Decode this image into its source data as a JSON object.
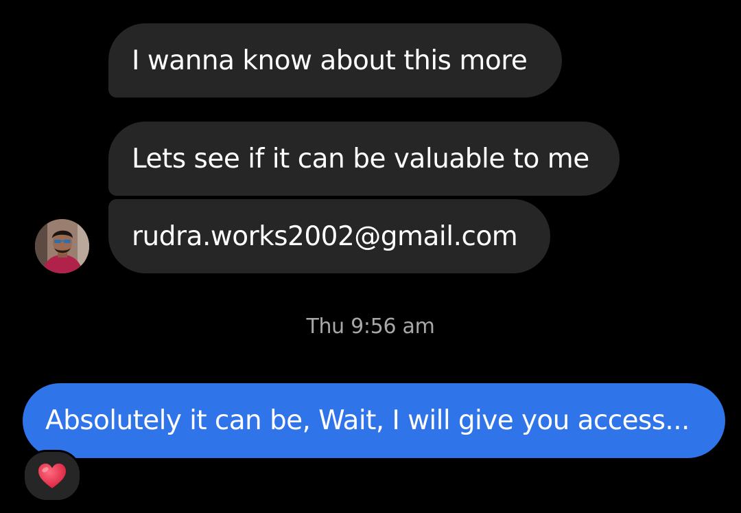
{
  "messages": [
    {
      "text": "I wanna know about this more"
    },
    {
      "text": "Lets see if it can be valuable to me"
    },
    {
      "text": "rudra.works2002@gmail.com"
    }
  ],
  "timestamp": "Thu 9:56 am",
  "reply": {
    "text": "Absolutely it can be, Wait, I will give you access..."
  },
  "reaction": {
    "icon": "heart-icon"
  },
  "colors": {
    "background": "#000000",
    "incoming_bubble": "#262626",
    "outgoing_bubble": "#2f74e8",
    "text": "#ffffff",
    "timestamp": "#a8a8a8",
    "reaction_heart": "#e8344a"
  }
}
